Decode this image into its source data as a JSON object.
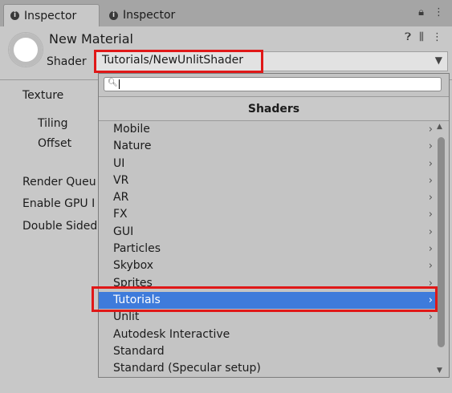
{
  "tabs": [
    {
      "label": "Inspector",
      "active": true
    },
    {
      "label": "Inspector",
      "active": false
    }
  ],
  "tabbar_icons": [
    "lock-icon",
    "menu-icon"
  ],
  "header": {
    "material_name": "New Material",
    "shader_label": "Shader",
    "shader_value": "Tutorials/NewUnlitShader",
    "icons": [
      "help-icon",
      "preset-icon",
      "more-icon"
    ]
  },
  "properties": {
    "texture": "Texture",
    "tiling": "Tiling",
    "offset": "Offset",
    "render_queue": "Render Queu",
    "enable_gpu": "Enable GPU I",
    "double_sided": "Double Sided"
  },
  "shader_menu": {
    "search_value": "",
    "title": "Shaders",
    "items": [
      {
        "label": "Mobile",
        "submenu": true
      },
      {
        "label": "Nature",
        "submenu": true
      },
      {
        "label": "UI",
        "submenu": true
      },
      {
        "label": "VR",
        "submenu": true
      },
      {
        "label": "AR",
        "submenu": true
      },
      {
        "label": "FX",
        "submenu": true
      },
      {
        "label": "GUI",
        "submenu": true
      },
      {
        "label": "Particles",
        "submenu": true
      },
      {
        "label": "Skybox",
        "submenu": true
      },
      {
        "label": "Sprites",
        "submenu": true
      },
      {
        "label": "Tutorials",
        "submenu": true,
        "selected": true
      },
      {
        "label": "Unlit",
        "submenu": true
      },
      {
        "label": "Autodesk Interactive",
        "submenu": false
      },
      {
        "label": "Standard",
        "submenu": false
      },
      {
        "label": "Standard (Specular setup)",
        "submenu": false
      }
    ]
  },
  "colors": {
    "selection": "#3e7bdb",
    "highlight_box": "#e01818",
    "panel_bg": "#c8c8c8"
  }
}
